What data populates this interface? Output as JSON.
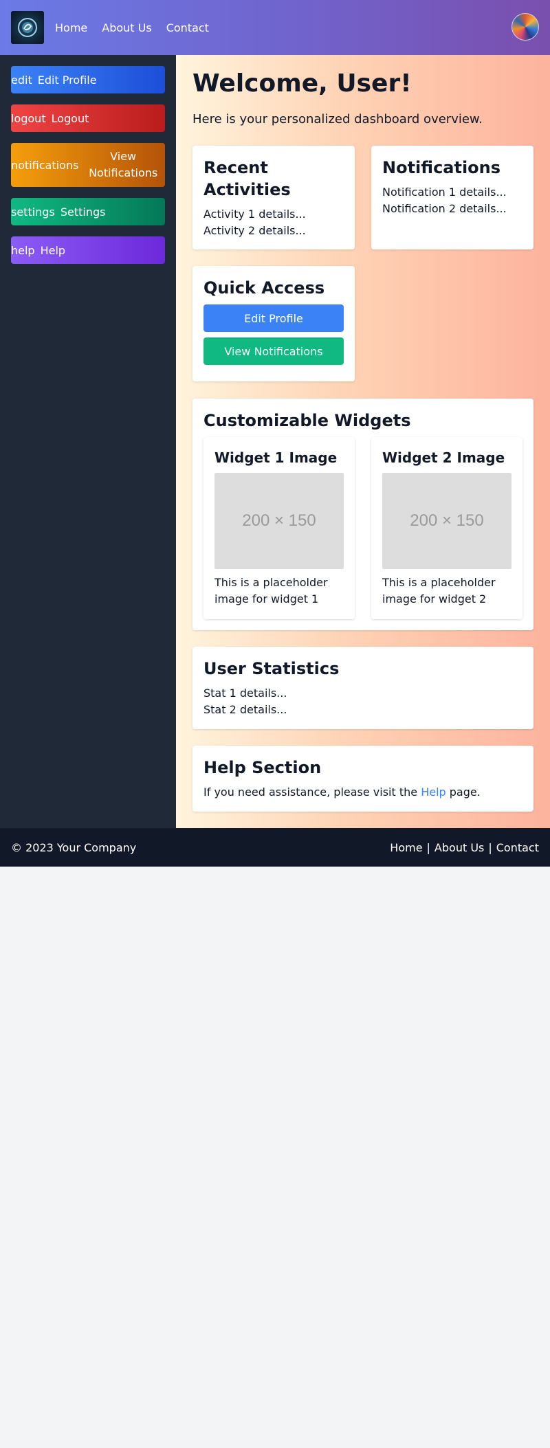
{
  "header": {
    "logo_alt": "logo",
    "nav": [
      "Home",
      "About Us",
      "Contact"
    ]
  },
  "sidebar": {
    "items": [
      {
        "icon": "edit",
        "label": "Edit Profile",
        "color": "#3b82f6"
      },
      {
        "icon": "logout",
        "label": "Logout",
        "color": "#ef4444"
      },
      {
        "icon": "notifications",
        "label": "View Notifications",
        "color": "#f59e0b"
      },
      {
        "icon": "settings",
        "label": "Settings",
        "color": "#10b981"
      },
      {
        "icon": "help",
        "label": "Help",
        "color": "#8b5cf6"
      }
    ]
  },
  "main": {
    "title": "Welcome, User!",
    "subtitle": "Here is your personalized dashboard overview.",
    "recent": {
      "title": "Recent Activities",
      "items": [
        "Activity 1 details...",
        "Activity 2 details..."
      ]
    },
    "notifications": {
      "title": "Notifications",
      "items": [
        "Notification 1 details...",
        "Notification 2 details..."
      ]
    },
    "quick_access": {
      "title": "Quick Access",
      "edit_label": "Edit Profile",
      "notif_label": "View Notifications"
    },
    "widgets": {
      "title": "Customizable Widgets",
      "items": [
        {
          "title": "Widget 1 Image",
          "placeholder": "200 × 150",
          "caption": "This is a placeholder image for widget 1"
        },
        {
          "title": "Widget 2 Image",
          "placeholder": "200 × 150",
          "caption": "This is a placeholder image for widget 2"
        }
      ]
    },
    "stats": {
      "title": "User Statistics",
      "items": [
        "Stat 1 details...",
        "Stat 2 details..."
      ]
    },
    "help": {
      "title": "Help Section",
      "text_before": "If you need assistance, please visit the ",
      "link": "Help",
      "text_after": " page."
    }
  },
  "footer": {
    "copyright": "© 2023 Your Company",
    "links": [
      "Home",
      "About Us",
      "Contact"
    ]
  },
  "colors": {
    "accent": "#3b82f6",
    "success": "#10b981",
    "sidebar_bg": "#1f2937",
    "footer_bg": "#111827"
  }
}
